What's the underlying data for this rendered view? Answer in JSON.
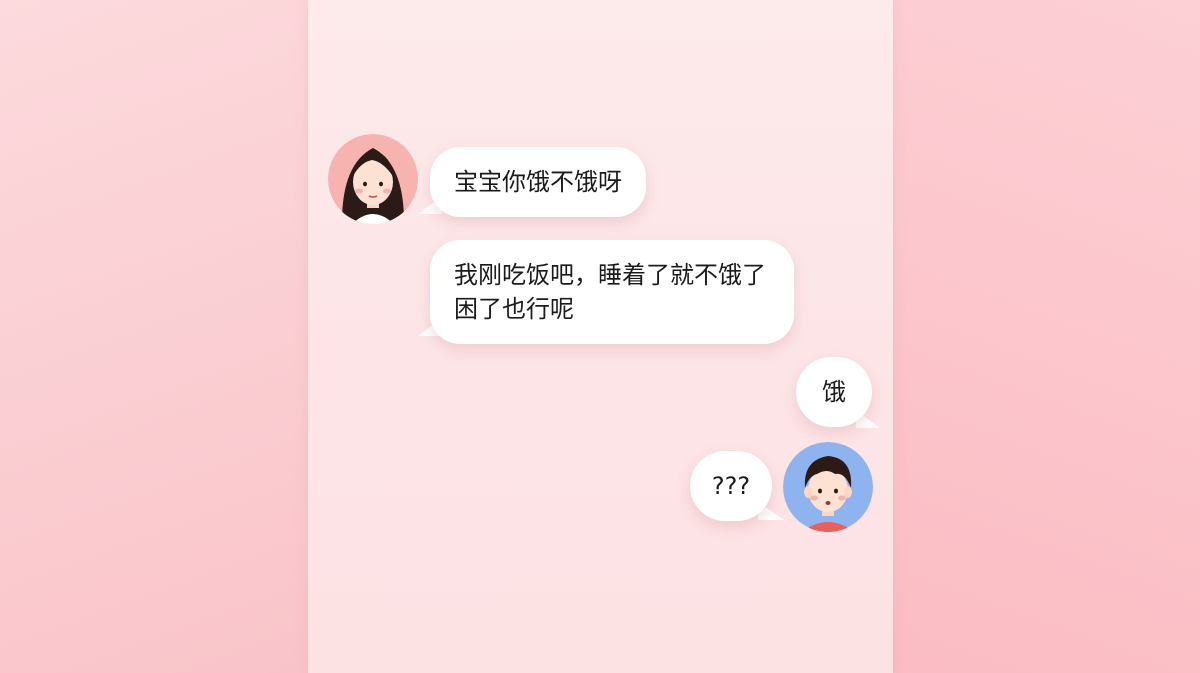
{
  "messages": [
    {
      "sender": "girl",
      "text": "宝宝你饿不饿呀"
    },
    {
      "sender": "girl",
      "line1": "我刚吃饭吧，睡着了就不饿了",
      "line2": "困了也行呢"
    },
    {
      "sender": "boy",
      "text": "饿"
    },
    {
      "sender": "boy",
      "text": "???"
    }
  ],
  "colors": {
    "girl_avatar_bg": "#f6b3b0",
    "boy_avatar_bg": "#8fb3ee",
    "bubble": "#ffffff"
  }
}
